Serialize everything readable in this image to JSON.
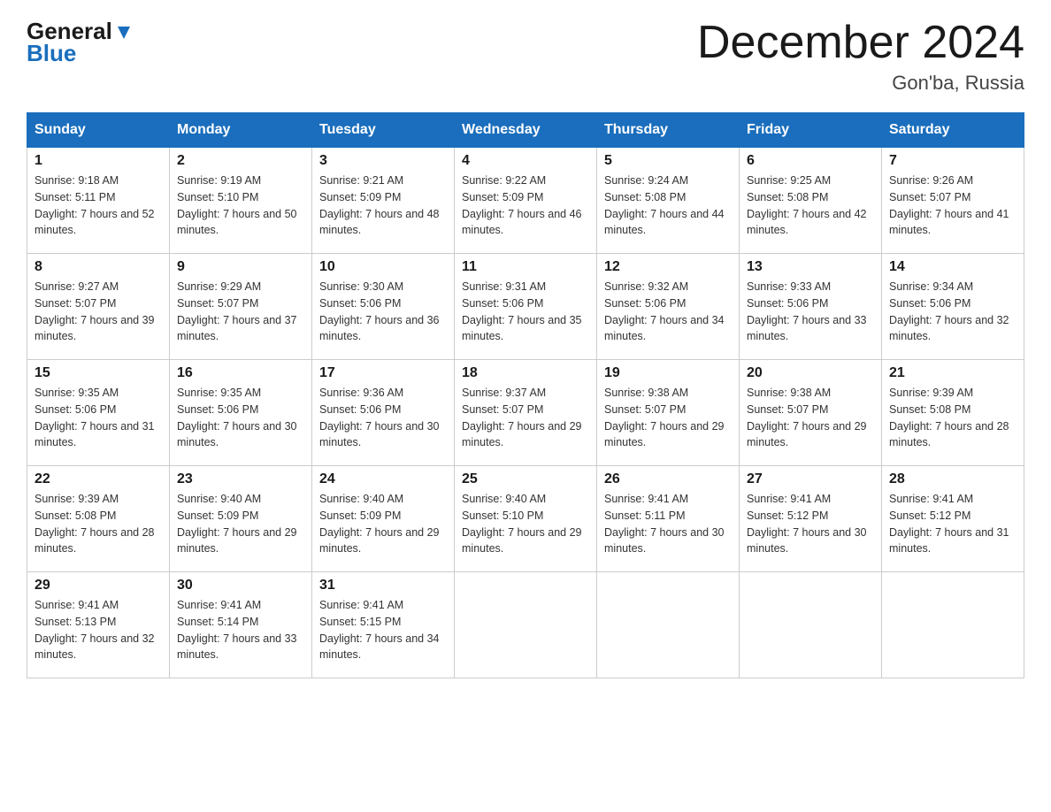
{
  "header": {
    "logo_general": "General",
    "logo_blue": "Blue",
    "title": "December 2024",
    "subtitle": "Gon'ba, Russia"
  },
  "columns": [
    "Sunday",
    "Monday",
    "Tuesday",
    "Wednesday",
    "Thursday",
    "Friday",
    "Saturday"
  ],
  "weeks": [
    [
      {
        "day": "1",
        "sunrise": "Sunrise: 9:18 AM",
        "sunset": "Sunset: 5:11 PM",
        "daylight": "Daylight: 7 hours and 52 minutes."
      },
      {
        "day": "2",
        "sunrise": "Sunrise: 9:19 AM",
        "sunset": "Sunset: 5:10 PM",
        "daylight": "Daylight: 7 hours and 50 minutes."
      },
      {
        "day": "3",
        "sunrise": "Sunrise: 9:21 AM",
        "sunset": "Sunset: 5:09 PM",
        "daylight": "Daylight: 7 hours and 48 minutes."
      },
      {
        "day": "4",
        "sunrise": "Sunrise: 9:22 AM",
        "sunset": "Sunset: 5:09 PM",
        "daylight": "Daylight: 7 hours and 46 minutes."
      },
      {
        "day": "5",
        "sunrise": "Sunrise: 9:24 AM",
        "sunset": "Sunset: 5:08 PM",
        "daylight": "Daylight: 7 hours and 44 minutes."
      },
      {
        "day": "6",
        "sunrise": "Sunrise: 9:25 AM",
        "sunset": "Sunset: 5:08 PM",
        "daylight": "Daylight: 7 hours and 42 minutes."
      },
      {
        "day": "7",
        "sunrise": "Sunrise: 9:26 AM",
        "sunset": "Sunset: 5:07 PM",
        "daylight": "Daylight: 7 hours and 41 minutes."
      }
    ],
    [
      {
        "day": "8",
        "sunrise": "Sunrise: 9:27 AM",
        "sunset": "Sunset: 5:07 PM",
        "daylight": "Daylight: 7 hours and 39 minutes."
      },
      {
        "day": "9",
        "sunrise": "Sunrise: 9:29 AM",
        "sunset": "Sunset: 5:07 PM",
        "daylight": "Daylight: 7 hours and 37 minutes."
      },
      {
        "day": "10",
        "sunrise": "Sunrise: 9:30 AM",
        "sunset": "Sunset: 5:06 PM",
        "daylight": "Daylight: 7 hours and 36 minutes."
      },
      {
        "day": "11",
        "sunrise": "Sunrise: 9:31 AM",
        "sunset": "Sunset: 5:06 PM",
        "daylight": "Daylight: 7 hours and 35 minutes."
      },
      {
        "day": "12",
        "sunrise": "Sunrise: 9:32 AM",
        "sunset": "Sunset: 5:06 PM",
        "daylight": "Daylight: 7 hours and 34 minutes."
      },
      {
        "day": "13",
        "sunrise": "Sunrise: 9:33 AM",
        "sunset": "Sunset: 5:06 PM",
        "daylight": "Daylight: 7 hours and 33 minutes."
      },
      {
        "day": "14",
        "sunrise": "Sunrise: 9:34 AM",
        "sunset": "Sunset: 5:06 PM",
        "daylight": "Daylight: 7 hours and 32 minutes."
      }
    ],
    [
      {
        "day": "15",
        "sunrise": "Sunrise: 9:35 AM",
        "sunset": "Sunset: 5:06 PM",
        "daylight": "Daylight: 7 hours and 31 minutes."
      },
      {
        "day": "16",
        "sunrise": "Sunrise: 9:35 AM",
        "sunset": "Sunset: 5:06 PM",
        "daylight": "Daylight: 7 hours and 30 minutes."
      },
      {
        "day": "17",
        "sunrise": "Sunrise: 9:36 AM",
        "sunset": "Sunset: 5:06 PM",
        "daylight": "Daylight: 7 hours and 30 minutes."
      },
      {
        "day": "18",
        "sunrise": "Sunrise: 9:37 AM",
        "sunset": "Sunset: 5:07 PM",
        "daylight": "Daylight: 7 hours and 29 minutes."
      },
      {
        "day": "19",
        "sunrise": "Sunrise: 9:38 AM",
        "sunset": "Sunset: 5:07 PM",
        "daylight": "Daylight: 7 hours and 29 minutes."
      },
      {
        "day": "20",
        "sunrise": "Sunrise: 9:38 AM",
        "sunset": "Sunset: 5:07 PM",
        "daylight": "Daylight: 7 hours and 29 minutes."
      },
      {
        "day": "21",
        "sunrise": "Sunrise: 9:39 AM",
        "sunset": "Sunset: 5:08 PM",
        "daylight": "Daylight: 7 hours and 28 minutes."
      }
    ],
    [
      {
        "day": "22",
        "sunrise": "Sunrise: 9:39 AM",
        "sunset": "Sunset: 5:08 PM",
        "daylight": "Daylight: 7 hours and 28 minutes."
      },
      {
        "day": "23",
        "sunrise": "Sunrise: 9:40 AM",
        "sunset": "Sunset: 5:09 PM",
        "daylight": "Daylight: 7 hours and 29 minutes."
      },
      {
        "day": "24",
        "sunrise": "Sunrise: 9:40 AM",
        "sunset": "Sunset: 5:09 PM",
        "daylight": "Daylight: 7 hours and 29 minutes."
      },
      {
        "day": "25",
        "sunrise": "Sunrise: 9:40 AM",
        "sunset": "Sunset: 5:10 PM",
        "daylight": "Daylight: 7 hours and 29 minutes."
      },
      {
        "day": "26",
        "sunrise": "Sunrise: 9:41 AM",
        "sunset": "Sunset: 5:11 PM",
        "daylight": "Daylight: 7 hours and 30 minutes."
      },
      {
        "day": "27",
        "sunrise": "Sunrise: 9:41 AM",
        "sunset": "Sunset: 5:12 PM",
        "daylight": "Daylight: 7 hours and 30 minutes."
      },
      {
        "day": "28",
        "sunrise": "Sunrise: 9:41 AM",
        "sunset": "Sunset: 5:12 PM",
        "daylight": "Daylight: 7 hours and 31 minutes."
      }
    ],
    [
      {
        "day": "29",
        "sunrise": "Sunrise: 9:41 AM",
        "sunset": "Sunset: 5:13 PM",
        "daylight": "Daylight: 7 hours and 32 minutes."
      },
      {
        "day": "30",
        "sunrise": "Sunrise: 9:41 AM",
        "sunset": "Sunset: 5:14 PM",
        "daylight": "Daylight: 7 hours and 33 minutes."
      },
      {
        "day": "31",
        "sunrise": "Sunrise: 9:41 AM",
        "sunset": "Sunset: 5:15 PM",
        "daylight": "Daylight: 7 hours and 34 minutes."
      },
      {
        "day": "",
        "sunrise": "",
        "sunset": "",
        "daylight": ""
      },
      {
        "day": "",
        "sunrise": "",
        "sunset": "",
        "daylight": ""
      },
      {
        "day": "",
        "sunrise": "",
        "sunset": "",
        "daylight": ""
      },
      {
        "day": "",
        "sunrise": "",
        "sunset": "",
        "daylight": ""
      }
    ]
  ]
}
